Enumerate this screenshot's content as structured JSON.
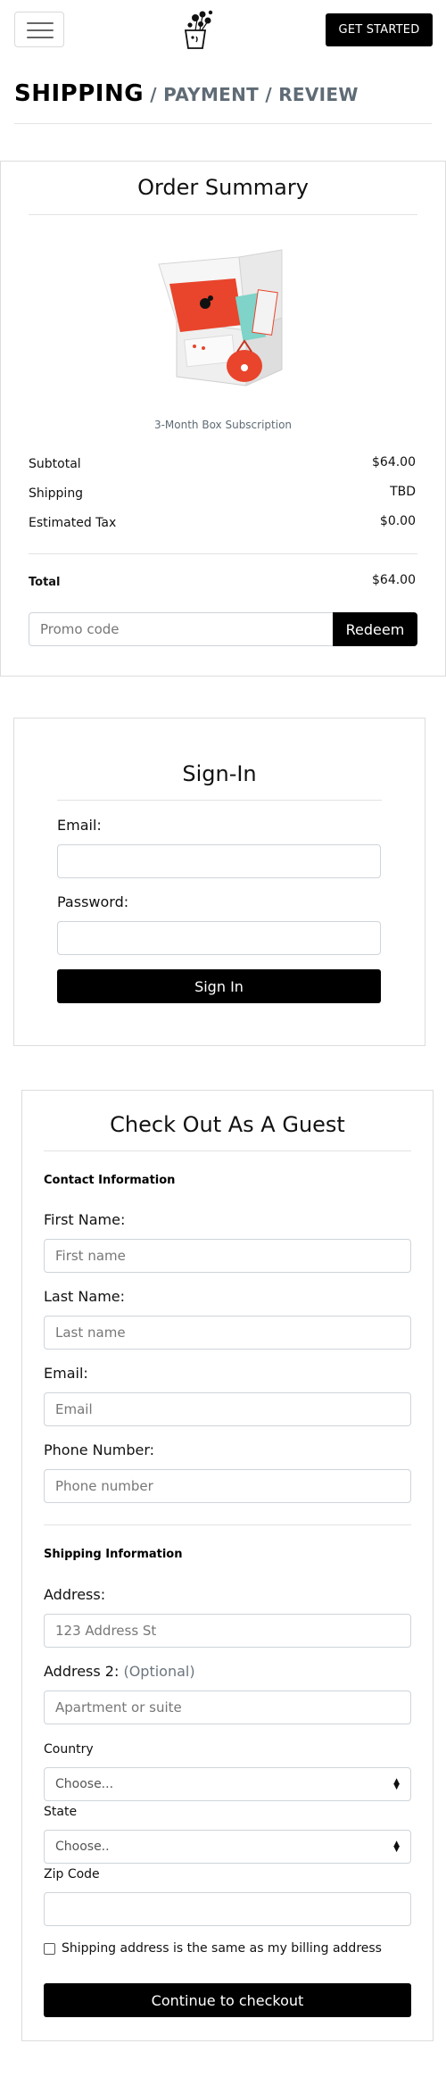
{
  "header": {
    "menu_icon": "hamburger-menu-icon",
    "logo_icon": "flower-pot-logo-icon",
    "cta_label": "GET STARTED"
  },
  "breadcrumb": {
    "active": "SHIPPING",
    "rest": " / PAYMENT / REVIEW"
  },
  "order_summary": {
    "title": "Order Summary",
    "product_name": "3-Month Box Subscription",
    "rows": [
      {
        "label": "Subtotal",
        "value": "$64.00"
      },
      {
        "label": "Shipping",
        "value": "TBD"
      },
      {
        "label": "Estimated Tax",
        "value": "$0.00"
      }
    ],
    "total_label": "Total",
    "total_value": "$64.00",
    "promo_placeholder": "Promo code",
    "redeem_label": "Redeem"
  },
  "signin": {
    "title": "Sign-In",
    "email_label": "Email:",
    "password_label": "Password:",
    "button_label": "Sign In"
  },
  "guest": {
    "title": "Check Out As A Guest",
    "contact_heading": "Contact Information",
    "first_name_label": "First Name:",
    "first_name_placeholder": "First name",
    "last_name_label": "Last Name:",
    "last_name_placeholder": "Last name",
    "email_label": "Email:",
    "email_placeholder": "Email",
    "phone_label": "Phone Number:",
    "phone_placeholder": "Phone number",
    "shipping_heading": "Shipping Information",
    "address_label": "Address:",
    "address_placeholder": "123 Address St",
    "address2_label": "Address 2:",
    "address2_optional": "(Optional)",
    "address2_placeholder": "Apartment or suite",
    "country_label": "Country",
    "country_selected": "Choose...",
    "state_label": "State",
    "state_selected": "Choose..",
    "zip_label": "Zip Code",
    "same_address_label": "Shipping address is the same as my billing address",
    "continue_label": "Continue to checkout"
  },
  "colors": {
    "accent": "#e8452c",
    "button": "#000000",
    "muted_text": "#5f6b75"
  }
}
